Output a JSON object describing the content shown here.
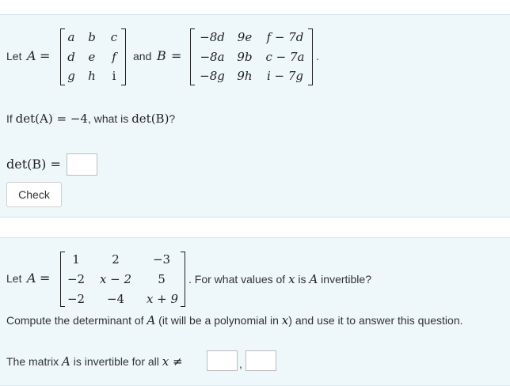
{
  "q1": {
    "let": "Let",
    "A": "A",
    "eq": "=",
    "matrix_a": [
      [
        "a",
        "b",
        "c"
      ],
      [
        "d",
        "e",
        "f"
      ],
      [
        "g",
        "h",
        "i"
      ]
    ],
    "and": "and",
    "B": "B",
    "matrix_b": [
      [
        "−8d",
        "9e",
        "f − 7d"
      ],
      [
        "−8a",
        "9b",
        "c − 7a"
      ],
      [
        "−8g",
        "9h",
        "i − 7g"
      ]
    ],
    "period": ".",
    "question_prefix": "If",
    "question_math_1": "det(A) = −4",
    "question_mid": ", what is",
    "question_math_2": "det(B)",
    "question_suffix": "?",
    "answer_label": "det(B) =",
    "check_label": "Check"
  },
  "q2": {
    "let": "Let",
    "A": "A",
    "eq": "=",
    "matrix": [
      [
        "1",
        "2",
        "−3"
      ],
      [
        "−2",
        "x − 2",
        "5"
      ],
      [
        "−2",
        "−4",
        "x + 9"
      ]
    ],
    "question_pre": ". For what values of",
    "question_x": "x",
    "question_mid": "is",
    "question_A": "A",
    "question_post": "invertible?",
    "compute_1": "Compute the determinant of",
    "compute_A": "A",
    "compute_2": "(it will be a polynomial in",
    "compute_x": "x",
    "compute_3": ") and use it to answer this question.",
    "answer_pre": "The matrix",
    "answer_A": "A",
    "answer_mid": "is invertible for all",
    "answer_x": "x ≠",
    "answer_sep": ","
  }
}
